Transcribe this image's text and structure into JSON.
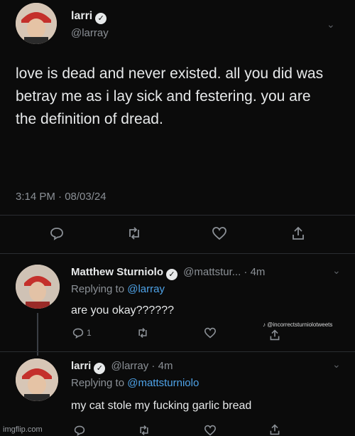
{
  "main_tweet": {
    "name": "larri",
    "handle": "@larray",
    "text": "love is dead and never existed. all you did was betray me as i lay sick and festering. you are the definition of dread.",
    "timestamp": "3:14 PM · 08/03/24"
  },
  "reply1": {
    "name": "Matthew Sturniolo",
    "handle_time": "@mattstur... · 4m",
    "replying_prefix": "Replying to ",
    "replying_to": "@larray",
    "text": "are you okay??????",
    "reply_count": "1",
    "watermark": "@incorrectsturniolotweets"
  },
  "reply2": {
    "name": "larri",
    "handle_time": "@larray · 4m",
    "replying_prefix": "Replying to ",
    "replying_to": "@mattsturniolo",
    "text": "my cat stole my fucking garlic bread"
  },
  "footer": {
    "imgflip": "imgflip.com"
  },
  "colors": {
    "background": "#0b0b0b",
    "text": "#e7e9ea",
    "muted": "#8b9096",
    "link": "#4ea3e8"
  }
}
